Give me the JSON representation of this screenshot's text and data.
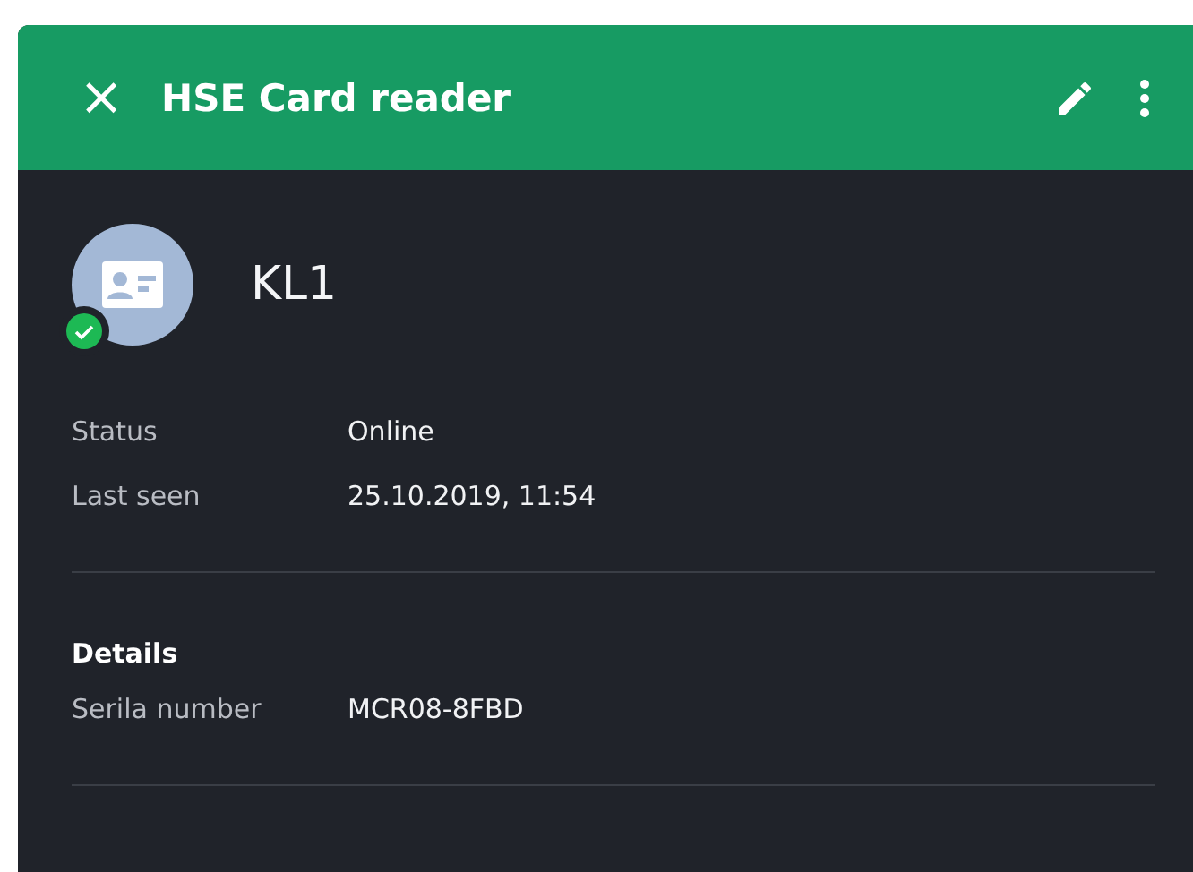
{
  "header": {
    "close": "×",
    "title": "HSE Card reader"
  },
  "device": {
    "name": "KL1",
    "online": true
  },
  "info_rows": [
    {
      "label": "Status",
      "value": "Online"
    },
    {
      "label": "Last seen",
      "value": "25.10.2019, 11:54"
    }
  ],
  "details": {
    "heading": "Details",
    "rows": [
      {
        "label": "Serila number",
        "value": "MCR08-8FBD"
      }
    ]
  }
}
